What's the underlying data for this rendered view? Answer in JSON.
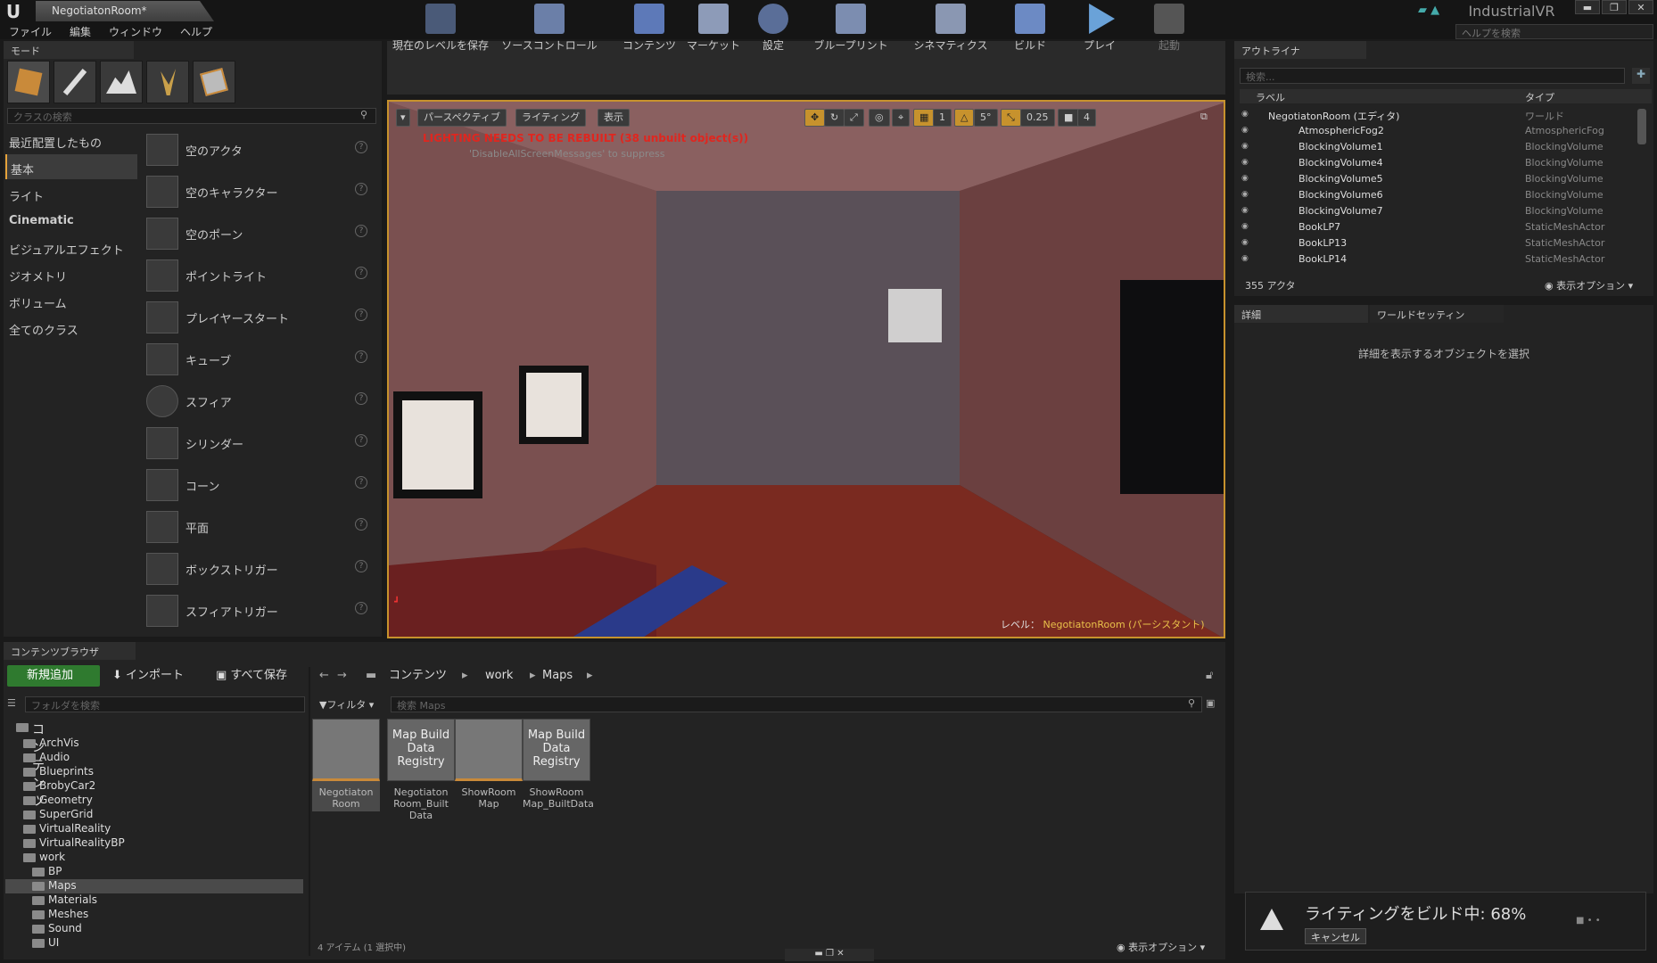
{
  "titlebar": {
    "doc_tab": "NegotiatonRoom*",
    "project": "IndustrialVR",
    "min": "▬",
    "max": "❐",
    "close": "✕"
  },
  "menubar": {
    "items": [
      "ファイル",
      "編集",
      "ウィンドウ",
      "ヘルプ"
    ],
    "help_placeholder": "ヘルプを検索"
  },
  "modes": {
    "tab": "モード",
    "search_placeholder": "クラスの検索",
    "categories": [
      "最近配置したもの",
      "基本",
      "ライト",
      "Cinematic",
      "ビジュアルエフェクト",
      "ジオメトリ",
      "ボリューム",
      "全てのクラス"
    ],
    "items": [
      "空のアクタ",
      "空のキャラクター",
      "空のポーン",
      "ポイントライト",
      "プレイヤースタート",
      "キューブ",
      "スフィア",
      "シリンダー",
      "コーン",
      "平面",
      "ボックストリガー",
      "スフィアトリガー"
    ]
  },
  "toolbar": {
    "buttons": [
      "現在のレベルを保存",
      "ソースコントロール",
      "コンテンツ",
      "マーケット",
      "設定",
      "ブループリント",
      "シネマティクス",
      "ビルド",
      "プレイ",
      "起動"
    ]
  },
  "viewport": {
    "perspective": "パースペクティブ",
    "lighting": "ライティング",
    "show": "表示",
    "grid_snap": "1",
    "rot_snap": "5°",
    "scale_snap": "0.25",
    "cam_speed": "4",
    "warning": "LIGHTING NEEDS TO BE REBUILT (38 unbuilt object(s))",
    "suppress": "'DisableAllScreenMessages' to suppress",
    "level_label": "レベル：",
    "level_name": "NegotiatonRoom (パーシスタント)"
  },
  "outliner": {
    "tab": "アウトライナ",
    "search_placeholder": "検索...",
    "col_label": "ラベル",
    "col_type": "タイプ",
    "rows": [
      {
        "name": "NegotiatonRoom (エディタ)",
        "type": "ワールド"
      },
      {
        "name": "AtmosphericFog2",
        "type": "AtmosphericFog"
      },
      {
        "name": "BlockingVolume1",
        "type": "BlockingVolume"
      },
      {
        "name": "BlockingVolume4",
        "type": "BlockingVolume"
      },
      {
        "name": "BlockingVolume5",
        "type": "BlockingVolume"
      },
      {
        "name": "BlockingVolume6",
        "type": "BlockingVolume"
      },
      {
        "name": "BlockingVolume7",
        "type": "BlockingVolume"
      },
      {
        "name": "BookLP7",
        "type": "StaticMeshActor"
      },
      {
        "name": "BookLP13",
        "type": "StaticMeshActor"
      },
      {
        "name": "BookLP14",
        "type": "StaticMeshActor"
      }
    ],
    "actor_count": "355 アクタ",
    "view_options": "表示オプション"
  },
  "details": {
    "tab": "詳細",
    "tab2": "ワールドセッティン",
    "empty": "詳細を表示するオブジェクトを選択"
  },
  "content": {
    "tab": "コンテンツブラウザ",
    "new": "新規追加",
    "import": "インポート",
    "save_all": "すべて保存",
    "path": [
      "コンテンツ",
      "work",
      "Maps"
    ],
    "folder_search": "フォルダを検索",
    "filter": "フィルタ",
    "search_placeholder": "検索 Maps",
    "tree": [
      "コンテンツ",
      "ArchVis",
      "Audio",
      "Blueprints",
      "BrobyCar2",
      "Geometry",
      "SuperGrid",
      "VirtualReality",
      "VirtualRealityBP",
      "work",
      "BP",
      "Maps",
      "Materials",
      "Meshes",
      "Sound",
      "UI"
    ],
    "assets": [
      {
        "tile": "",
        "label": "Negotiaton Room"
      },
      {
        "tile": "Map Build Data Registry",
        "label": "Negotiaton Room_Built Data"
      },
      {
        "tile": "",
        "label": "ShowRoom Map"
      },
      {
        "tile": "Map Build Data Registry",
        "label": "ShowRoom Map_BuiltData"
      }
    ],
    "status": "4 アイテム (1 選択中)",
    "view_options": "表示オプション"
  },
  "build": {
    "text": "ライティングをビルド中: 68%",
    "cancel": "キャンセル"
  }
}
